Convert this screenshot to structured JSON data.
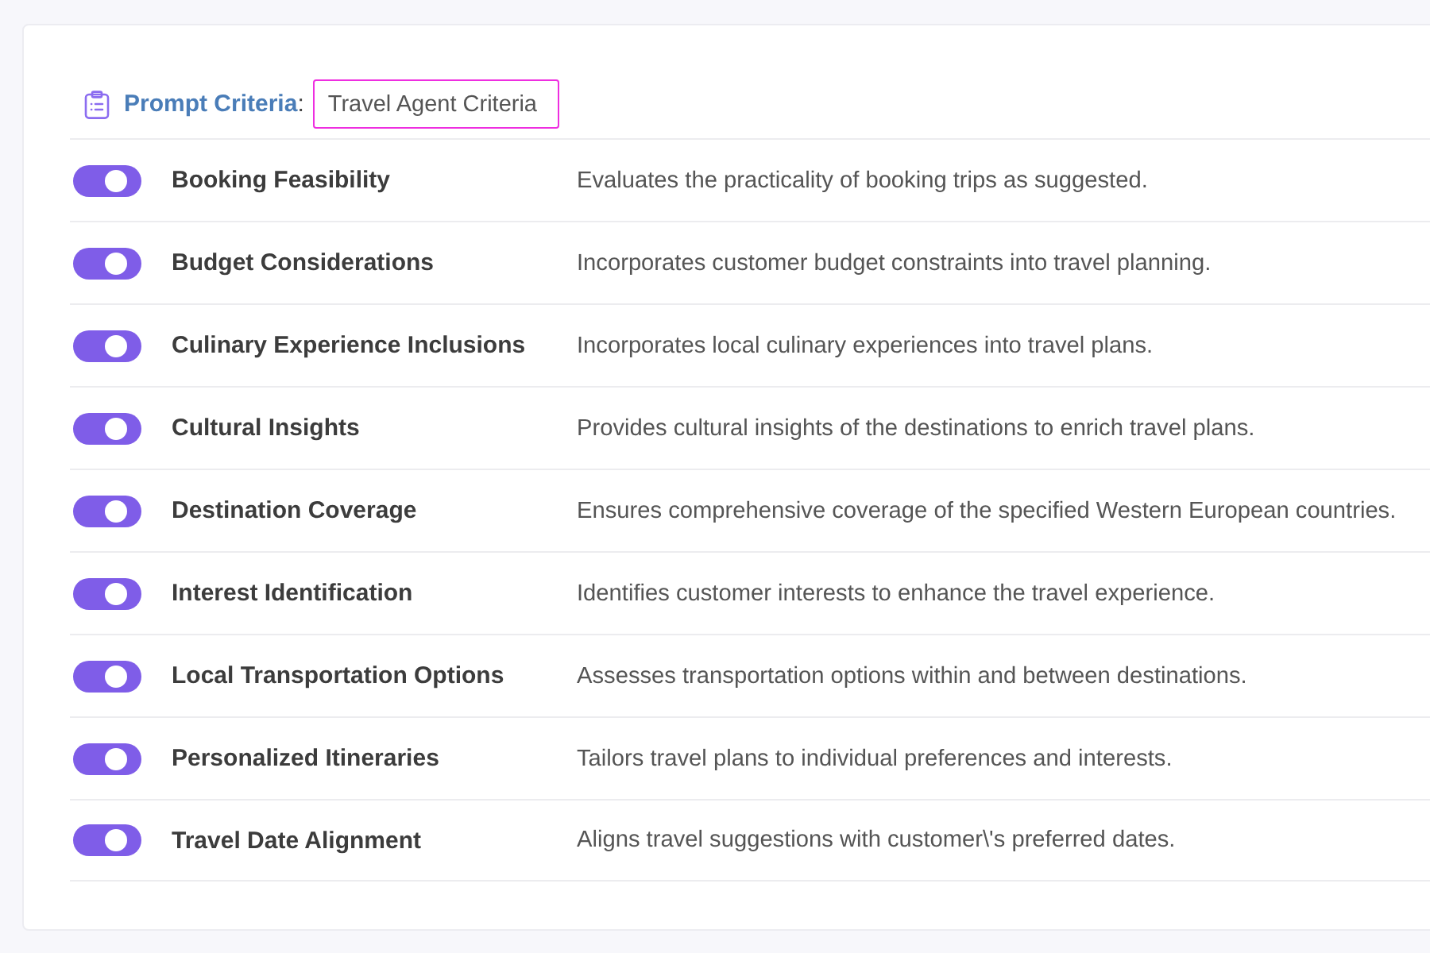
{
  "header": {
    "label": "Prompt Criteria",
    "separator": ":",
    "value": "Travel Agent Criteria"
  },
  "criteria": [
    {
      "name": "Booking Feasibility",
      "description": "Evaluates the practicality of booking trips as suggested.",
      "on": true
    },
    {
      "name": "Budget Considerations",
      "description": "Incorporates customer budget constraints into travel planning.",
      "on": true
    },
    {
      "name": "Culinary Experience Inclusions",
      "description": "Incorporates local culinary experiences into travel plans.",
      "on": true
    },
    {
      "name": "Cultural Insights",
      "description": "Provides cultural insights of the destinations to enrich travel plans.",
      "on": true
    },
    {
      "name": "Destination Coverage",
      "description": "Ensures comprehensive coverage of the specified Western European countries.",
      "on": true
    },
    {
      "name": "Interest Identification",
      "description": "Identifies customer interests to enhance the travel experience.",
      "on": true
    },
    {
      "name": "Local Transportation Options",
      "description": "Assesses transportation options within and between destinations.",
      "on": true
    },
    {
      "name": "Personalized Itineraries",
      "description": "Tailors travel plans to individual preferences and interests.",
      "on": true
    },
    {
      "name": "Travel Date Alignment",
      "description": "Aligns travel suggestions with customer\\'s preferred dates.",
      "on": true
    }
  ]
}
